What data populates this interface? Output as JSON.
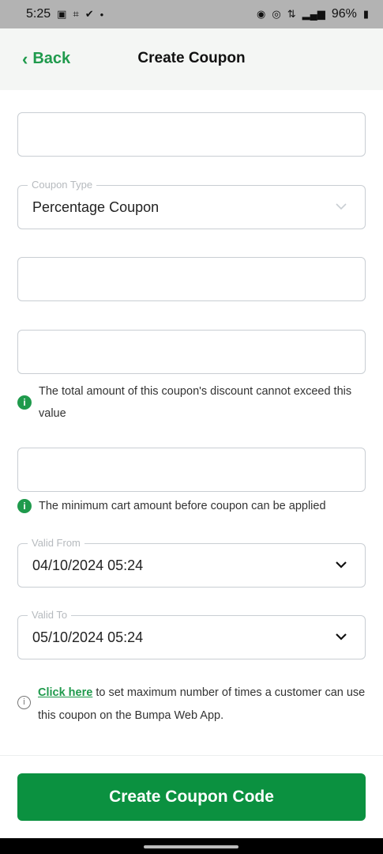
{
  "status_bar": {
    "time": "5:25",
    "battery": "96%"
  },
  "header": {
    "back_label": "Back",
    "title": "Create Coupon"
  },
  "form": {
    "coupon_code": {
      "value": ""
    },
    "coupon_type": {
      "label": "Coupon Type",
      "value": "Percentage Coupon"
    },
    "discount_value": {
      "value": ""
    },
    "max_discount": {
      "value": "",
      "hint": "The total amount of this coupon's discount cannot exceed this value"
    },
    "min_cart": {
      "value": "",
      "hint": "The minimum cart amount before coupon can be applied"
    },
    "valid_from": {
      "label": "Valid From",
      "value": "04/10/2024 05:24"
    },
    "valid_to": {
      "label": "Valid To",
      "value": "05/10/2024 05:24"
    }
  },
  "usage_note": {
    "link_text": "Click here",
    "text": " to set maximum number of times a customer can use this coupon on the Bumpa Web App."
  },
  "footer": {
    "submit_label": "Create Coupon Code"
  },
  "colors": {
    "accent": "#1f9a4c",
    "button": "#0b9140"
  }
}
